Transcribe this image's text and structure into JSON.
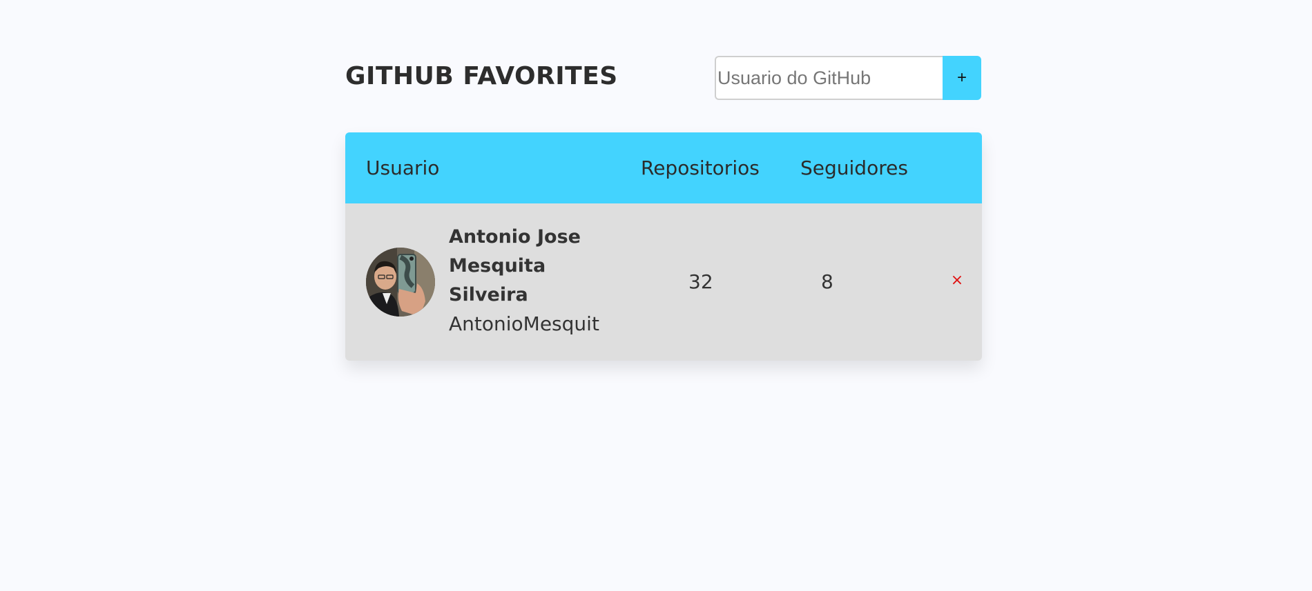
{
  "header": {
    "title": "GITHUB FAVORITES",
    "search_placeholder": "Usuario do GitHub",
    "search_value": "",
    "add_label": "+"
  },
  "table": {
    "columns": [
      "Usuario",
      "Repositorios",
      "Seguidores"
    ],
    "rows": [
      {
        "name": "Antonio Jose Mesquita Silveira",
        "login": "AntonioMesquit",
        "repositories": "32",
        "followers": "8",
        "remove_label": "×",
        "avatar_icon": "user-avatar-photo"
      }
    ]
  },
  "colors": {
    "accent": "#43d3fe",
    "background": "#f9fafe",
    "row_background": "#dedede",
    "remove": "#e01010"
  }
}
